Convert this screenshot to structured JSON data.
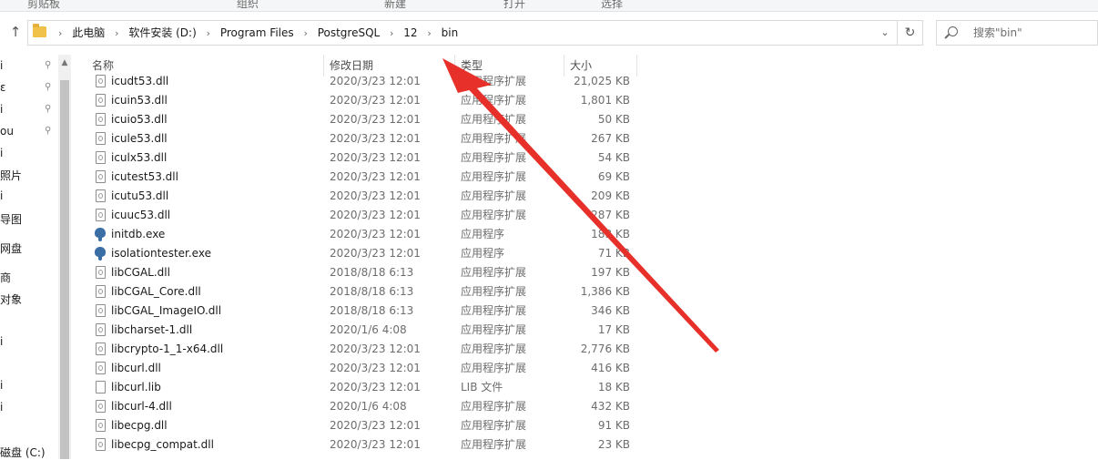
{
  "ribbon": {
    "groups": [
      "剪贴板",
      "组织",
      "新建",
      "打开",
      "选择"
    ]
  },
  "address": {
    "crumbs": [
      "此电脑",
      "软件安装 (D:)",
      "Program Files",
      "PostgreSQL",
      "12",
      "bin"
    ]
  },
  "search": {
    "placeholder": "搜索\"bin\""
  },
  "nav_pane": {
    "items": [
      "i",
      "ɛ",
      "i",
      "ou",
      "i",
      "照片",
      "i",
      "导图",
      "网盘",
      "商",
      "对象",
      "i",
      "i",
      "i",
      "磁盘 (C:)"
    ]
  },
  "columns": {
    "name": "名称",
    "date": "修改日期",
    "type": "类型",
    "size": "大小"
  },
  "files": [
    {
      "name": "icudt53.dll",
      "date": "2020/3/23 12:01",
      "type": "应用程序扩展",
      "size": "21,025 KB",
      "icon": "dll-file-icon"
    },
    {
      "name": "icuin53.dll",
      "date": "2020/3/23 12:01",
      "type": "应用程序扩展",
      "size": "1,801 KB",
      "icon": "dll-file-icon"
    },
    {
      "name": "icuio53.dll",
      "date": "2020/3/23 12:01",
      "type": "应用程序扩展",
      "size": "50 KB",
      "icon": "dll-file-icon"
    },
    {
      "name": "icule53.dll",
      "date": "2020/3/23 12:01",
      "type": "应用程序扩展",
      "size": "267 KB",
      "icon": "dll-file-icon"
    },
    {
      "name": "iculx53.dll",
      "date": "2020/3/23 12:01",
      "type": "应用程序扩展",
      "size": "54 KB",
      "icon": "dll-file-icon"
    },
    {
      "name": "icutest53.dll",
      "date": "2020/3/23 12:01",
      "type": "应用程序扩展",
      "size": "69 KB",
      "icon": "dll-file-icon"
    },
    {
      "name": "icutu53.dll",
      "date": "2020/3/23 12:01",
      "type": "应用程序扩展",
      "size": "209 KB",
      "icon": "dll-file-icon"
    },
    {
      "name": "icuuc53.dll",
      "date": "2020/3/23 12:01",
      "type": "应用程序扩展",
      "size": "287 KB",
      "icon": "dll-file-icon"
    },
    {
      "name": "initdb.exe",
      "date": "2020/3/23 12:01",
      "type": "应用程序",
      "size": "183 KB",
      "icon": "postgres-elephant-icon"
    },
    {
      "name": "isolationtester.exe",
      "date": "2020/3/23 12:01",
      "type": "应用程序",
      "size": "71 KB",
      "icon": "postgres-elephant-icon"
    },
    {
      "name": "libCGAL.dll",
      "date": "2018/8/18 6:13",
      "type": "应用程序扩展",
      "size": "197 KB",
      "icon": "dll-file-icon"
    },
    {
      "name": "libCGAL_Core.dll",
      "date": "2018/8/18 6:13",
      "type": "应用程序扩展",
      "size": "1,386 KB",
      "icon": "dll-file-icon"
    },
    {
      "name": "libCGAL_ImageIO.dll",
      "date": "2018/8/18 6:13",
      "type": "应用程序扩展",
      "size": "346 KB",
      "icon": "dll-file-icon"
    },
    {
      "name": "libcharset-1.dll",
      "date": "2020/1/6 4:08",
      "type": "应用程序扩展",
      "size": "17 KB",
      "icon": "dll-file-icon"
    },
    {
      "name": "libcrypto-1_1-x64.dll",
      "date": "2020/3/23 12:01",
      "type": "应用程序扩展",
      "size": "2,776 KB",
      "icon": "dll-file-icon"
    },
    {
      "name": "libcurl.dll",
      "date": "2020/3/23 12:01",
      "type": "应用程序扩展",
      "size": "416 KB",
      "icon": "dll-file-icon"
    },
    {
      "name": "libcurl.lib",
      "date": "2020/3/23 12:01",
      "type": "LIB 文件",
      "size": "18 KB",
      "icon": "generic-file-icon"
    },
    {
      "name": "libcurl-4.dll",
      "date": "2020/1/6 4:08",
      "type": "应用程序扩展",
      "size": "432 KB",
      "icon": "dll-file-icon"
    },
    {
      "name": "libecpg.dll",
      "date": "2020/3/23 12:01",
      "type": "应用程序扩展",
      "size": "91 KB",
      "icon": "dll-file-icon"
    },
    {
      "name": "libecpg_compat.dll",
      "date": "2020/3/23 12:01",
      "type": "应用程序扩展",
      "size": "23 KB",
      "icon": "dll-file-icon"
    }
  ],
  "colors": {
    "annotation_arrow": "#e8302a",
    "folder": "#f0c24a",
    "exe_icon": "#3a6ea5"
  }
}
